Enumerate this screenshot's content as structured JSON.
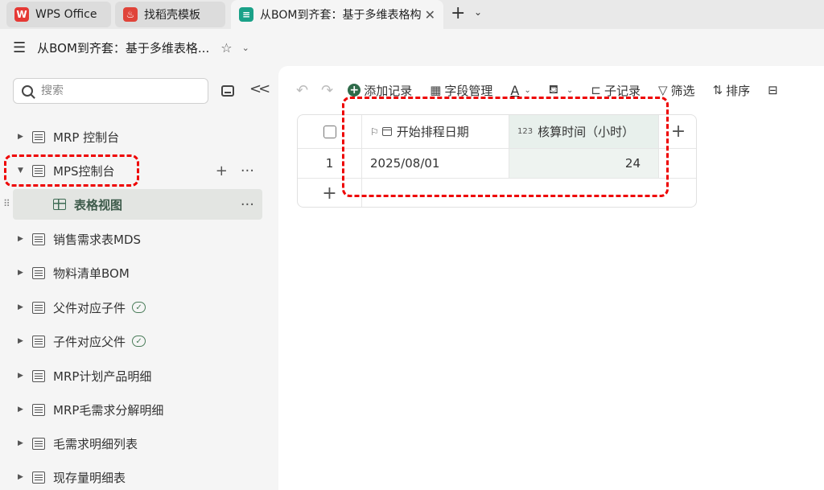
{
  "tabs": [
    {
      "label": "WPS Office",
      "icon": "wps-logo-icon"
    },
    {
      "label": "找稻壳模板",
      "icon": "docer-icon"
    },
    {
      "label": "从BOM到齐套：基于多维表格构建",
      "icon": "multidim-table-icon"
    }
  ],
  "titlebar": {
    "title": "从BOM到齐套：基于多维表格..."
  },
  "sidebar": {
    "search_placeholder": "搜索",
    "items": [
      {
        "label": "MRP 控制台"
      },
      {
        "label": "MPS控制台"
      },
      {
        "label": "表格视图"
      },
      {
        "label": "销售需求表MDS"
      },
      {
        "label": "物料清单BOM"
      },
      {
        "label": "父件对应子件"
      },
      {
        "label": "子件对应父件"
      },
      {
        "label": "MRP计划产品明细"
      },
      {
        "label": "MRP毛需求分解明细"
      },
      {
        "label": "毛需求明细列表"
      },
      {
        "label": "现存量明细表"
      }
    ]
  },
  "toolbar": {
    "add_record": "添加记录",
    "field_manage": "字段管理",
    "text_color": "A",
    "sub_record": "子记录",
    "filter": "筛选",
    "sort": "排序"
  },
  "table": {
    "columns": [
      {
        "label": "开始排程日期",
        "prefix": ""
      },
      {
        "label": "核算时间（小时）",
        "prefix": "123"
      }
    ],
    "rows": [
      {
        "index": "1",
        "start_date": "2025/08/01",
        "hours": "24"
      }
    ]
  },
  "colors": {
    "accent": "#2f6b4a",
    "highlight": "#e00000",
    "selected_col": "#e8f0ec"
  }
}
